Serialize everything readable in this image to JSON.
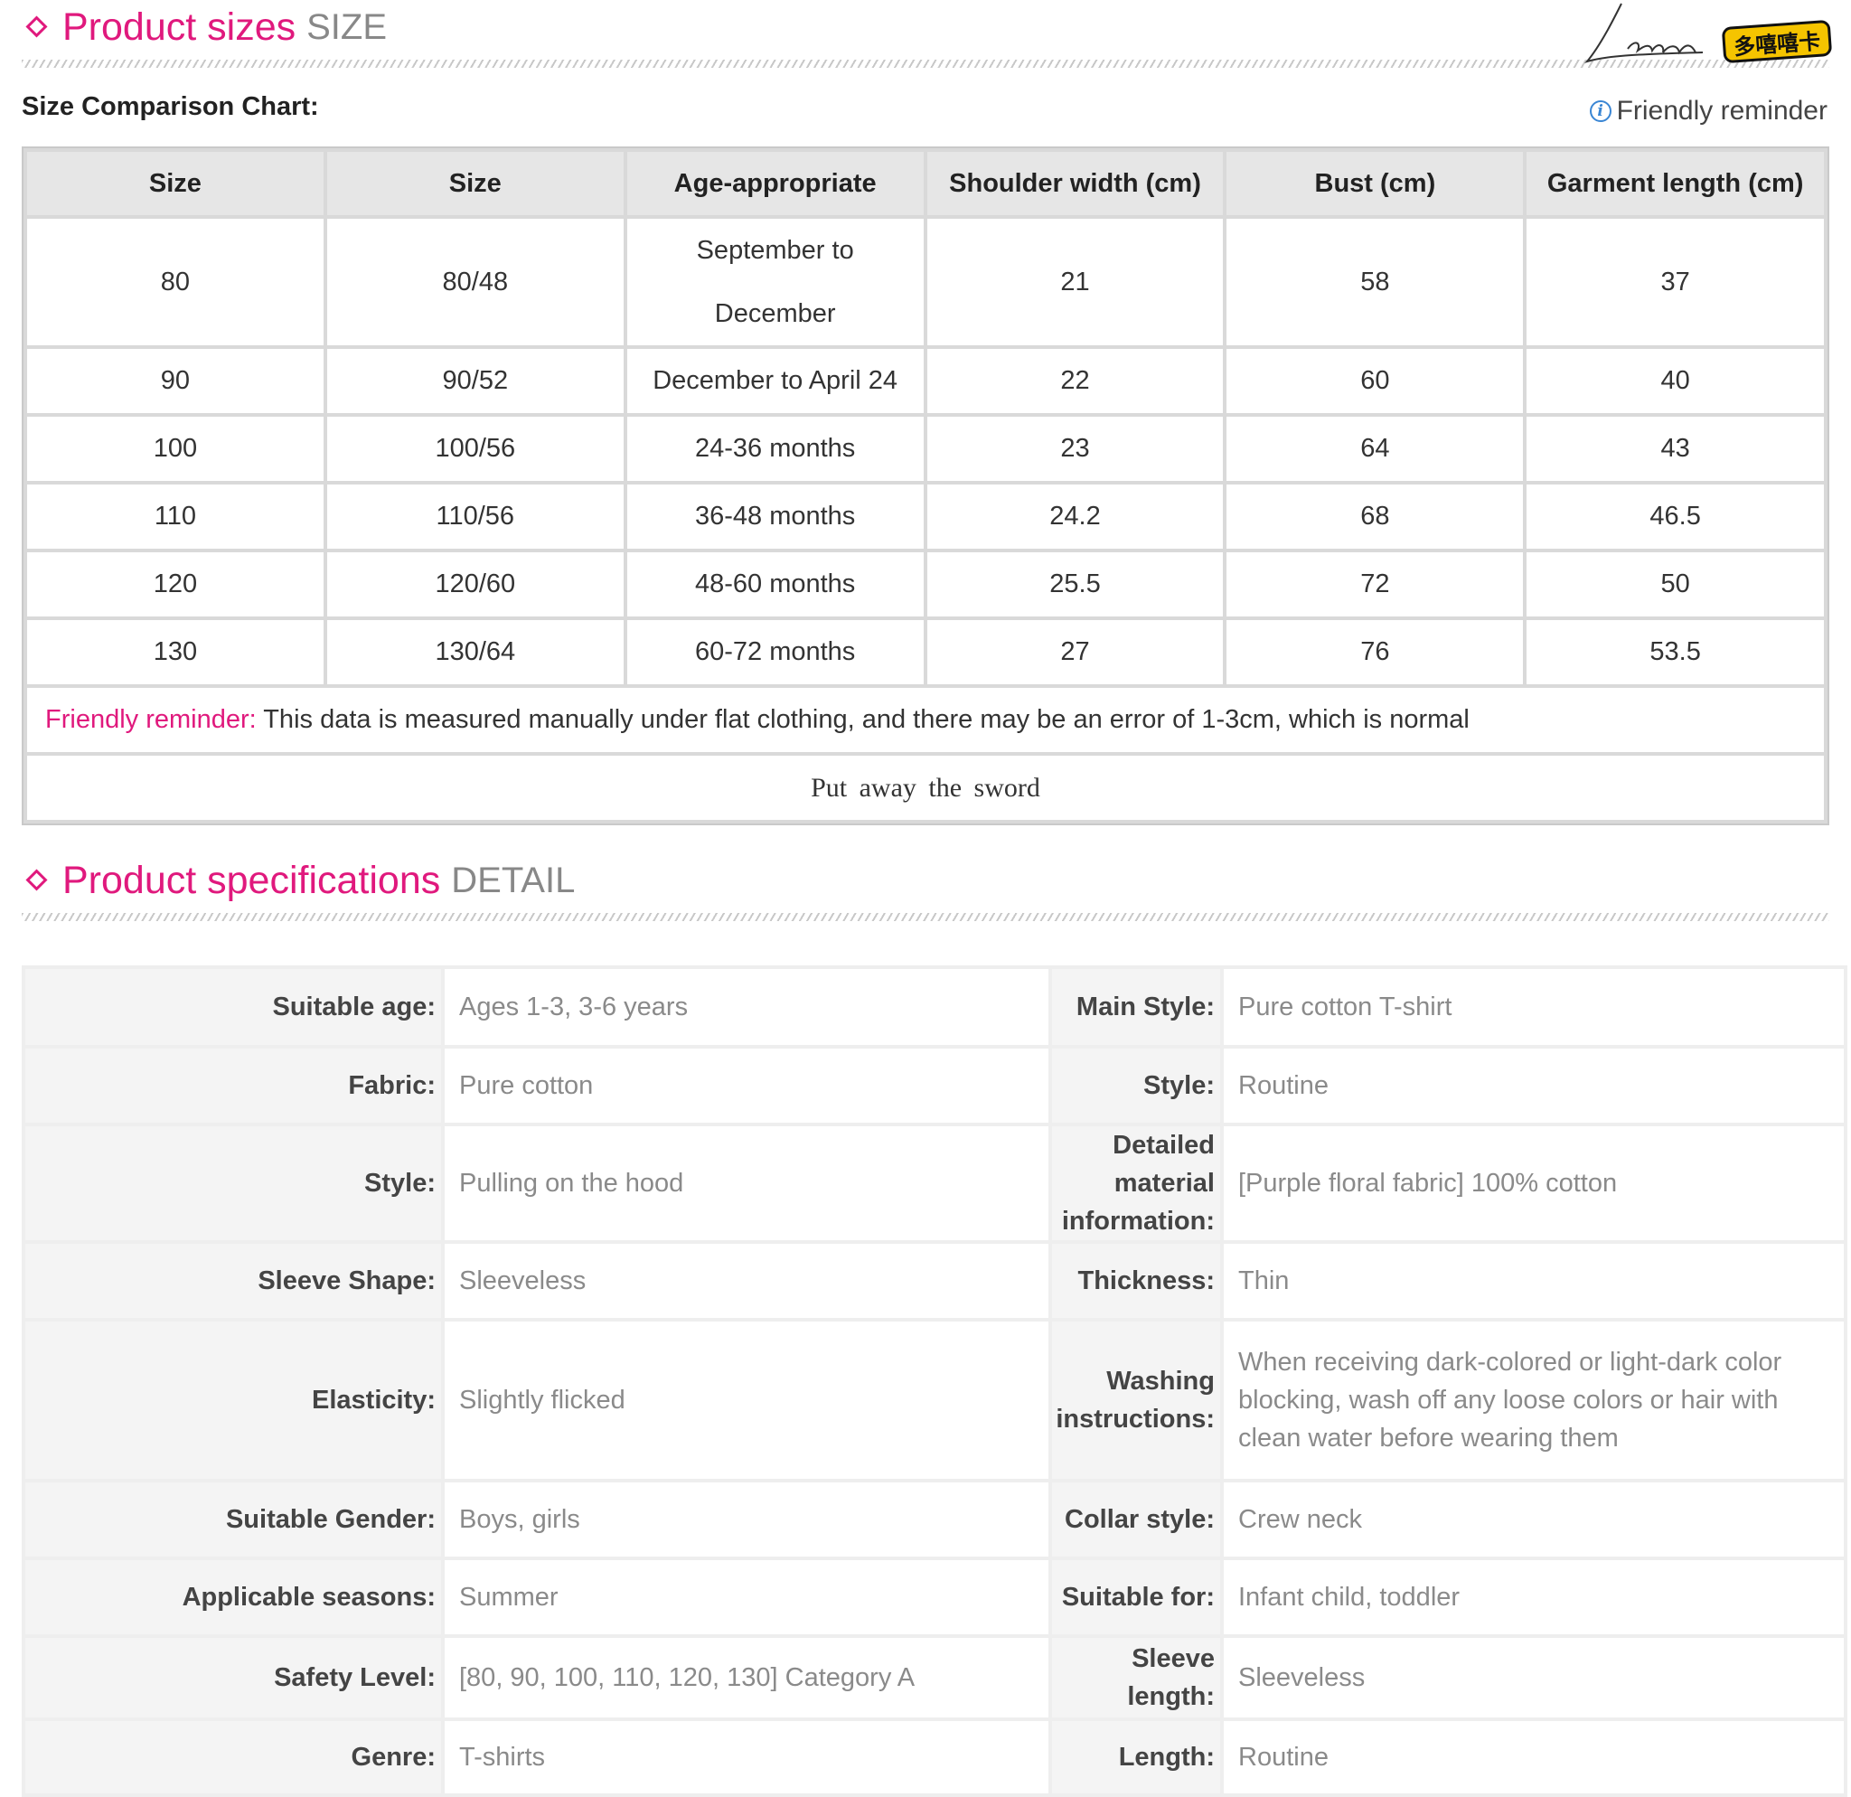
{
  "sizes_section": {
    "title": "Product sizes",
    "subtitle": "SIZE"
  },
  "logo": {
    "signature": "Laléh",
    "badge": "多嘻嘻卡"
  },
  "chart_label": "Size Comparison Chart:",
  "reminder_link": "Friendly reminder",
  "size_table": {
    "headers": [
      "Size",
      "Size",
      "Age-appropriate",
      "Shoulder width (cm)",
      "Bust (cm)",
      "Garment length (cm)"
    ],
    "rows": [
      [
        "80",
        "80/48",
        "September to December",
        "21",
        "58",
        "37"
      ],
      [
        "90",
        "90/52",
        "December to April 24",
        "22",
        "60",
        "40"
      ],
      [
        "100",
        "100/56",
        "24-36 months",
        "23",
        "64",
        "43"
      ],
      [
        "110",
        "110/56",
        "36-48 months",
        "24.2",
        "68",
        "46.5"
      ],
      [
        "120",
        "120/60",
        "48-60 months",
        "25.5",
        "72",
        "50"
      ],
      [
        "130",
        "130/64",
        "60-72 months",
        "27",
        "76",
        "53.5"
      ]
    ],
    "note_label": "Friendly reminder:",
    "note_text": " This data is measured manually under flat clothing, and there may be an error of 1-3cm, which is normal",
    "footer": "Put away the sword"
  },
  "spec_section": {
    "title": "Product specifications",
    "subtitle": "DETAIL"
  },
  "specs": [
    {
      "lk": "Suitable age:",
      "lv": "Ages 1-3, 3-6 years",
      "rk": "Main Style:",
      "rv": "Pure cotton T-shirt"
    },
    {
      "lk": "Fabric:",
      "lv": "Pure cotton",
      "rk": "Style:",
      "rv": "Routine"
    },
    {
      "lk": "Style:",
      "lv": "Pulling on the hood",
      "rk": "Detailed material information:",
      "rv": "[Purple floral fabric] 100% cotton"
    },
    {
      "lk": "Sleeve Shape:",
      "lv": "Sleeveless",
      "rk": "Thickness:",
      "rv": "Thin"
    },
    {
      "lk": "Elasticity:",
      "lv": "Slightly flicked",
      "rk": "Washing instructions:",
      "rv": "When receiving dark-colored or light-dark color blocking, wash off any loose colors or hair with clean water before wearing them"
    },
    {
      "lk": "Suitable Gender:",
      "lv": "Boys, girls",
      "rk": "Collar style:",
      "rv": "Crew neck"
    },
    {
      "lk": "Applicable seasons:",
      "lv": "Summer",
      "rk": "Suitable for:",
      "rv": "Infant child, toddler"
    },
    {
      "lk": "Safety Level:",
      "lv": "[80, 90, 100, 110, 120, 130] Category A",
      "rk": "Sleeve length:",
      "rv": "Sleeveless"
    },
    {
      "lk": "Genre:",
      "lv": "T-shirts",
      "rk": "Length:",
      "rv": "Routine"
    }
  ]
}
